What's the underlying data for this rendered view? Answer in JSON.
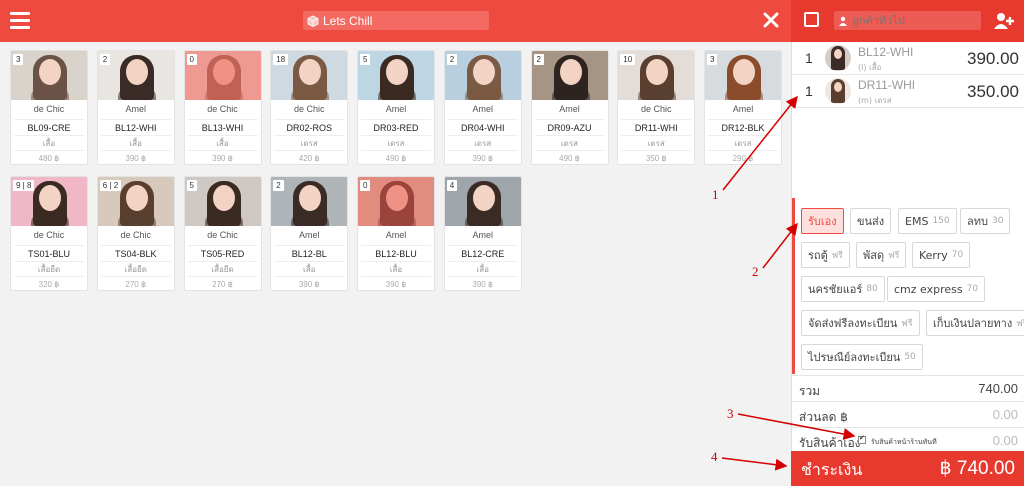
{
  "header": {
    "search_value": "Lets Chill",
    "customer_placeholder": "ลูกค้าทั่วไป"
  },
  "products": [
    {
      "count": "3",
      "brand": "de Chic",
      "sku": "BL09-CRE",
      "category": "เสื้อ",
      "price": "480 ฿",
      "tone": "#6b5247",
      "bg": "#d9d3cc",
      "out": false
    },
    {
      "count": "2",
      "brand": "Amel",
      "sku": "BL12-WHI",
      "category": "เสื้อ",
      "price": "390 ฿",
      "tone": "#3a2b26",
      "bg": "#e9e5e1",
      "out": false
    },
    {
      "count": "0",
      "brand": "de Chic",
      "sku": "BL13-WHI",
      "category": "เสื้อ",
      "price": "390 ฿",
      "tone": "#8a6a58",
      "bg": "#f1e8e3",
      "out": true
    },
    {
      "count": "18",
      "brand": "de Chic",
      "sku": "DR02-ROS",
      "category": "เดรส",
      "price": "420 ฿",
      "tone": "#7a5a44",
      "bg": "#cfd9e2",
      "out": false
    },
    {
      "count": "5",
      "brand": "Amel",
      "sku": "DR03-RED",
      "category": "เดรส",
      "price": "490 ฿",
      "tone": "#3b2a22",
      "bg": "#bcd6e4",
      "out": false
    },
    {
      "count": "2",
      "brand": "Amel",
      "sku": "DR04-WHI",
      "category": "เดรส",
      "price": "390 ฿",
      "tone": "#7a5a44",
      "bg": "#b8cfe0",
      "out": false
    },
    {
      "count": "2",
      "brand": "Amel",
      "sku": "DR09-AZU",
      "category": "เดรส",
      "price": "490 ฿",
      "tone": "#2e2420",
      "bg": "#a69484",
      "out": false
    },
    {
      "count": "10",
      "brand": "de Chic",
      "sku": "DR11-WHI",
      "category": "เดรส",
      "price": "350 ฿",
      "tone": "#5a3f30",
      "bg": "#e4ddd7",
      "out": false
    },
    {
      "count": "3",
      "brand": "Amel",
      "sku": "DR12-BLK",
      "category": "เดรส",
      "price": "290 ฿",
      "tone": "#8b4c2b",
      "bg": "#d6dbe0",
      "out": false
    },
    {
      "count": "9 | 8",
      "brand": "de Chic",
      "sku": "TS01-BLU",
      "category": "เสื้อยืด",
      "price": "320 ฿",
      "tone": "#3a2a22",
      "bg": "#f0b8c6",
      "out": false
    },
    {
      "count": "6 | 2",
      "brand": "de Chic",
      "sku": "TS04-BLK",
      "category": "เสื้อยืด",
      "price": "270 ฿",
      "tone": "#5a3f30",
      "bg": "#d7c9bb",
      "out": false
    },
    {
      "count": "5",
      "brand": "de Chic",
      "sku": "TS05-RED",
      "category": "เสื้อยืด",
      "price": "270 ฿",
      "tone": "#3b2a22",
      "bg": "#cfc7c1",
      "out": false
    },
    {
      "count": "2",
      "brand": "Amel",
      "sku": "BL12-BL",
      "category": "เสื้อ",
      "price": "390 ฿",
      "tone": "#3a2b26",
      "bg": "#aeb4b8",
      "out": false
    },
    {
      "count": "0",
      "brand": "Amel",
      "sku": "BL12-BLU",
      "category": "เสื้อ",
      "price": "390 ฿",
      "tone": "#3a2b26",
      "bg": "#d7c9bb",
      "out": true
    },
    {
      "count": "4",
      "brand": "Amel",
      "sku": "BL12-CRE",
      "category": "เสื้อ",
      "price": "390 ฿",
      "tone": "#3a2b26",
      "bg": "#9ea6ab",
      "out": false
    }
  ],
  "cart": [
    {
      "qty": "1",
      "sku": "BL12-WHI",
      "sub": "(l) เสื้อ",
      "amount": "390.00",
      "tone": "#3a2b26",
      "bg": "#d7ccc4"
    },
    {
      "qty": "1",
      "sku": "DR11-WHI",
      "sub": "(m) เดรส",
      "amount": "350.00",
      "tone": "#5a3f30",
      "bg": "#efe6e0"
    }
  ],
  "shipping_options": [
    {
      "label": "รับเอง",
      "fee": "",
      "active": true
    },
    {
      "label": "ขนส่ง",
      "fee": "",
      "active": false
    },
    {
      "label": "EMS",
      "fee": "150",
      "active": false
    },
    {
      "label": "ลทบ",
      "fee": "30",
      "active": false
    },
    {
      "label": "รถตู้",
      "fee": "ฟรี",
      "active": false
    },
    {
      "label": "พัสดุ",
      "fee": "ฟรี",
      "active": false
    },
    {
      "label": "Kerry",
      "fee": "70",
      "active": false
    },
    {
      "label": "นครชัยแอร์",
      "fee": "80",
      "active": false
    },
    {
      "label": "cmz express",
      "fee": "70",
      "active": false
    },
    {
      "label": "จัดส่งฟรีลงทะเบียน",
      "fee": "ฟรี",
      "active": false
    },
    {
      "label": "เก็บเงินปลายทาง",
      "fee": "ฟรี",
      "active": false
    },
    {
      "label": "ไปรษณีย์ลงทะเบียน",
      "fee": "50",
      "active": false
    }
  ],
  "summary": {
    "total_label": "รวม",
    "total_value": "740.00",
    "discount_label": "ส่วนลด ฿",
    "discount_value": "0.00",
    "pickup_label": "รับสินค้าเอง",
    "pickup_checkbox_label": "รับสินค้าหน้าร้านทันที",
    "pickup_value": "0.00"
  },
  "pay": {
    "label": "ชำระเงิน",
    "amount": "฿ 740.00"
  },
  "annotations": [
    "1",
    "2",
    "3",
    "4"
  ],
  "colors": {
    "accent": "#ef4a3f",
    "accent_dark": "#e8392f",
    "annotation": "#d40000"
  }
}
